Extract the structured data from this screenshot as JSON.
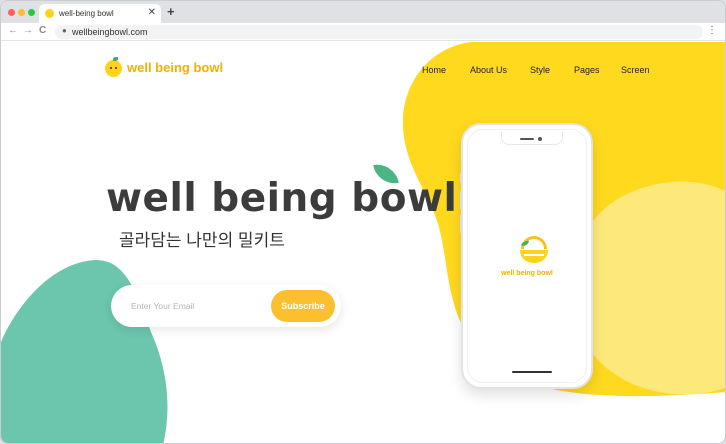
{
  "browser": {
    "tab_title": "well-being bowl",
    "tab_close": "✕",
    "new_tab": "+",
    "back": "←",
    "forward": "→",
    "reload": "C",
    "url": "wellbeingbowl.com",
    "menu": "⋮"
  },
  "site": {
    "logo_text": "well being bowl",
    "nav": [
      "Home",
      "About Us",
      "Style",
      "Pages",
      "Screen"
    ]
  },
  "hero": {
    "title": "well being bowl",
    "subtitle": "골라담는 나만의 밀키트"
  },
  "subscribe": {
    "email_placeholder": "Enter Your Email",
    "button_label": "Subscribe"
  },
  "phone": {
    "app_name": "well being bowl"
  },
  "colors": {
    "yellow": "#ffd91e",
    "light_yellow": "#fde97a",
    "green": "#6bc6ad",
    "button": "#fcc02f"
  }
}
